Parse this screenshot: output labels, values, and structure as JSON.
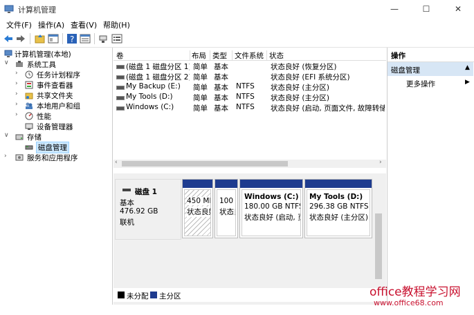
{
  "window": {
    "title": "计算机管理",
    "min_icon": "minimize-icon",
    "max_icon": "maximize-icon",
    "close_icon": "close-icon"
  },
  "menu": [
    "文件(F)",
    "操作(A)",
    "查看(V)",
    "帮助(H)"
  ],
  "tree": {
    "root": "计算机管理(本地)",
    "system_tools": "系统工具",
    "task_scheduler": "任务计划程序",
    "event_viewer": "事件查看器",
    "shared_folders": "共享文件夹",
    "local_users": "本地用户和组",
    "performance": "性能",
    "device_manager": "设备管理器",
    "storage": "存储",
    "disk_management": "磁盘管理",
    "services": "服务和应用程序"
  },
  "volume_table": {
    "headers": [
      "卷",
      "布局",
      "类型",
      "文件系统",
      "状态"
    ],
    "rows": [
      [
        "(磁盘 1 磁盘分区 1)",
        "简单",
        "基本",
        "",
        "状态良好 (恢复分区)"
      ],
      [
        "(磁盘 1 磁盘分区 2)",
        "简单",
        "基本",
        "",
        "状态良好 (EFI 系统分区)"
      ],
      [
        "My Backup (E:)",
        "简单",
        "基本",
        "NTFS",
        "状态良好 (主分区)"
      ],
      [
        "My Tools (D:)",
        "简单",
        "基本",
        "NTFS",
        "状态良好 (主分区)"
      ],
      [
        "Windows (C:)",
        "简单",
        "基本",
        "NTFS",
        "状态良好 (启动, 页面文件, 故障转储,"
      ]
    ]
  },
  "disk": {
    "name": "磁盘 1",
    "type": "基本",
    "size": "476.92 GB",
    "status": "联机",
    "partitions": [
      {
        "size": "450 MI",
        "status": "状态良好"
      },
      {
        "size": "100",
        "status": "状态良"
      },
      {
        "name": "Windows  (C:)",
        "size": "180.00 GB NTFS",
        "status": "状态良好 (启动, 页"
      },
      {
        "name": "My Tools  (D:)",
        "size": "296.38 GB NTFS",
        "status": "状态良好 (主分区)"
      }
    ]
  },
  "legend": {
    "unallocated": "未分配",
    "primary": "主分区",
    "unallocated_color": "#000000",
    "primary_color": "#1e3b8f"
  },
  "actions": {
    "header": "操作",
    "selected": "磁盘管理",
    "more": "更多操作"
  },
  "watermark": {
    "line1": "office教程学习网",
    "line2": "www.office68.com"
  }
}
